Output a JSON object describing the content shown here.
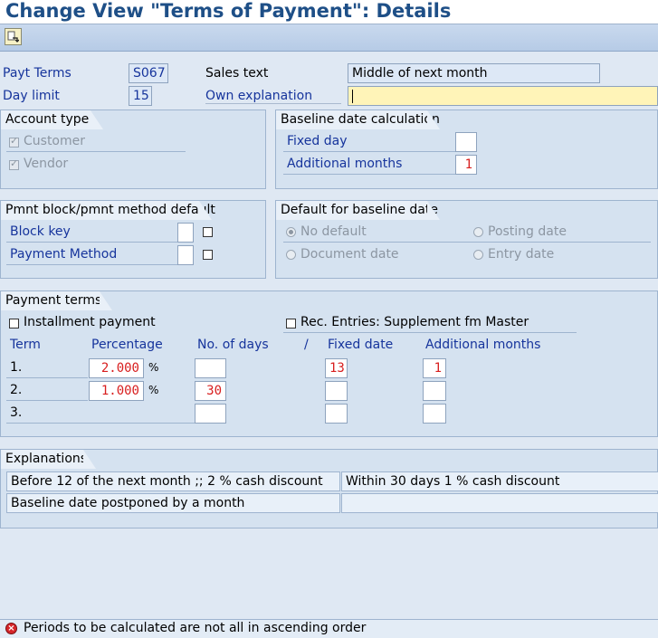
{
  "window": {
    "title": "Change View \"Terms of Payment\": Details"
  },
  "toolbar": {
    "icon": "display-change-icon"
  },
  "header": {
    "payt_terms_label": "Payt Terms",
    "payt_terms_value": "S067",
    "day_limit_label": "Day limit",
    "day_limit_value": "15",
    "sales_text_label": "Sales text",
    "sales_text_value": "Middle of next month",
    "own_explanation_label": "Own explanation",
    "own_explanation_value": ""
  },
  "account_type": {
    "title": "Account type",
    "customer_label": "Customer",
    "customer_checked": true,
    "vendor_label": "Vendor",
    "vendor_checked": true
  },
  "baseline_calc": {
    "title": "Baseline date calculation",
    "fixed_day_label": "Fixed day",
    "fixed_day_value": "",
    "additional_months_label": "Additional months",
    "additional_months_value": "1"
  },
  "pmnt_block": {
    "title": "Pmnt block/pmnt method default",
    "block_key_label": "Block key",
    "payment_method_label": "Payment Method"
  },
  "default_baseline": {
    "title": "Default for baseline date",
    "no_default": "No default",
    "posting_date": "Posting date",
    "document_date": "Document date",
    "entry_date": "Entry date",
    "selected": "No default"
  },
  "payment_terms": {
    "title": "Payment terms",
    "installment_label": "Installment payment",
    "rec_entries_label": "Rec. Entries: Supplement fm Master",
    "columns": {
      "term": "Term",
      "percentage": "Percentage",
      "no_of_days": "No. of days",
      "slash": "/",
      "fixed_date": "Fixed date",
      "additional_months": "Additional months"
    },
    "percent_sign": "%",
    "rows": [
      {
        "term": "1.",
        "percentage": "2.000",
        "days": "",
        "fixed_date": "13",
        "add_months": "1"
      },
      {
        "term": "2.",
        "percentage": "1.000",
        "days": "30",
        "fixed_date": "",
        "add_months": ""
      },
      {
        "term": "3.",
        "percentage": "",
        "days": "",
        "fixed_date": "",
        "add_months": ""
      }
    ]
  },
  "explanations": {
    "title": "Explanations",
    "line1_left": "Before 12 of the next month ;; 2 % cash discount",
    "line1_right": "Within 30 days 1 % cash discount",
    "line2_left": "Baseline date postponed by a month",
    "line2_right": ""
  },
  "status_bar": {
    "type": "error",
    "message": "Periods to be calculated are not all in ascending order"
  }
}
